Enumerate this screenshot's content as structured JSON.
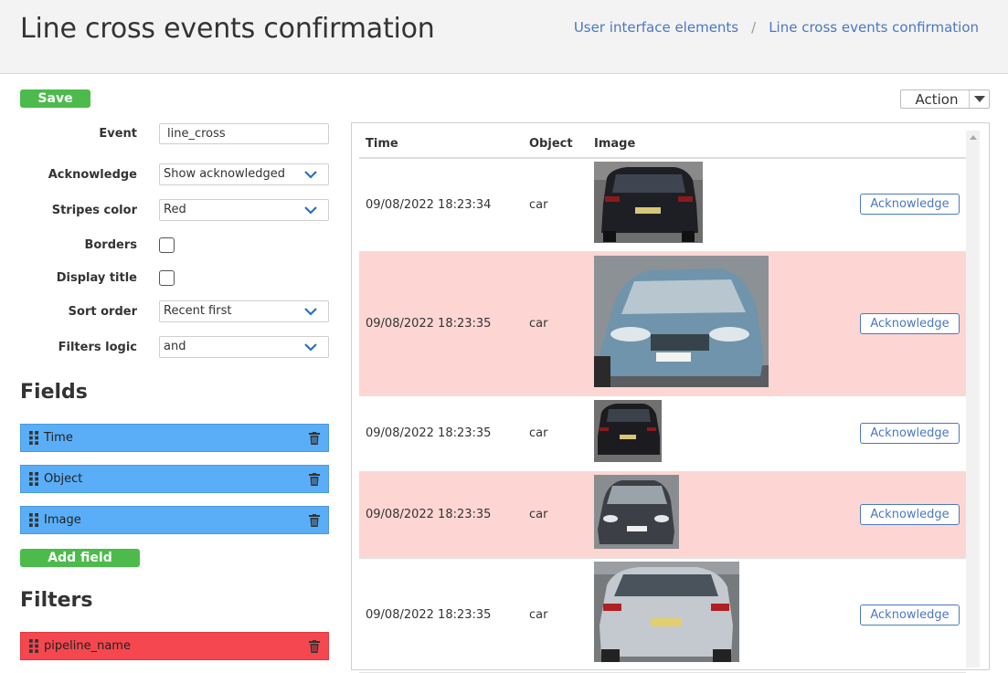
{
  "header": {
    "title": "Line cross events confirmation",
    "breadcrumb": [
      "User interface elements",
      "Line cross events confirmation"
    ],
    "breadcrumb_separator": "/"
  },
  "toolbar": {
    "save_label": "Save",
    "action_label": "Action"
  },
  "settings": {
    "event": {
      "label": "Event",
      "value": "line_cross"
    },
    "acknowledge": {
      "label": "Acknowledge",
      "value": "Show acknowledged"
    },
    "stripes_color": {
      "label": "Stripes color",
      "value": "Red"
    },
    "borders": {
      "label": "Borders",
      "checked": false
    },
    "display_title": {
      "label": "Display title",
      "checked": false
    },
    "sort_order": {
      "label": "Sort order",
      "value": "Recent first"
    },
    "filters_logic": {
      "label": "Filters logic",
      "value": "and"
    }
  },
  "fields": {
    "title": "Fields",
    "items": [
      {
        "name": "Time",
        "color": "#5aaef7"
      },
      {
        "name": "Object",
        "color": "#5aaef7"
      },
      {
        "name": "Image",
        "color": "#5aaef7"
      }
    ],
    "add_label": "Add field"
  },
  "filters": {
    "title": "Filters",
    "items": [
      {
        "name": "pipeline_name",
        "color": "#f5474f"
      }
    ]
  },
  "table": {
    "columns": [
      "Time",
      "Object",
      "Image"
    ],
    "rows": [
      {
        "time": "09/08/2022 18:23:34",
        "object": "car",
        "image": "car-rear-dark-suv",
        "highlighted": false,
        "action": "Acknowledge"
      },
      {
        "time": "09/08/2022 18:23:35",
        "object": "car",
        "image": "car-front-blue-hatchback",
        "highlighted": true,
        "action": "Acknowledge"
      },
      {
        "time": "09/08/2022 18:23:35",
        "object": "car",
        "image": "car-rear-dark-suv-small",
        "highlighted": false,
        "action": "Acknowledge"
      },
      {
        "time": "09/08/2022 18:23:35",
        "object": "car",
        "image": "car-front-grey-hatchback",
        "highlighted": true,
        "action": "Acknowledge"
      },
      {
        "time": "09/08/2022 18:23:35",
        "object": "car",
        "image": "car-rear-silver-mpv",
        "highlighted": false,
        "action": "Acknowledge"
      }
    ]
  },
  "colors": {
    "accent_green": "#4cbb4c",
    "link_blue": "#4a78c2",
    "field_blue": "#5aaef7",
    "filter_red": "#f5474f",
    "highlight_pink": "#fdd6d3"
  }
}
